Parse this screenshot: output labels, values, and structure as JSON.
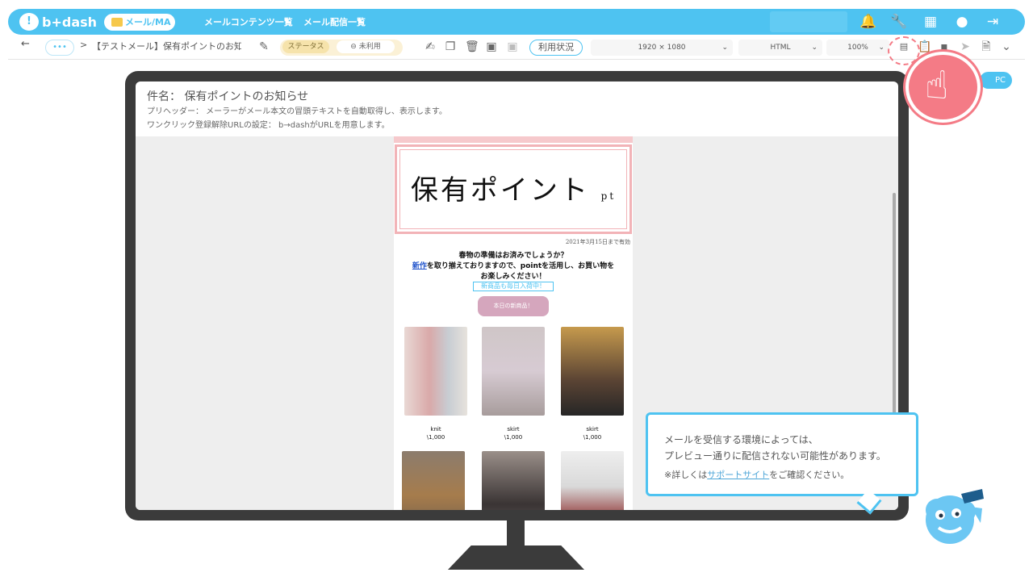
{
  "header": {
    "logo": "b+dash",
    "logo_mark": "!",
    "mail_ma": "メール/MA",
    "nav1": "メールコンテンツ一覧",
    "nav2": "メール配信一覧"
  },
  "toolbar": {
    "back": "←",
    "more": "•••",
    "crumb_sep": ">",
    "breadcrumb": "【テストメール】保有ポイントのお知…",
    "status": "ステータス",
    "unused": "未利用",
    "usage": "利用状況",
    "resolution": "1920 × 1080",
    "format": "HTML",
    "zoom": "100%"
  },
  "mail": {
    "subject_label": "件名：",
    "subject": "保有ポイントのお知らせ",
    "preheader": "プリヘッダー： メーラーがメール本文の冒頭テキストを自動取得し、表示します。",
    "unsubscribe": "ワンクリック登録解除URLの設定： b→dashがURLを用意します。"
  },
  "email_body": {
    "hero": "保有ポイント",
    "hero_unit": "pt",
    "expire": "2021年3月15日まで有効",
    "line1": "春物の準備はお済みでしょうか？",
    "line2_link": "新作",
    "line2": "を取り揃えておりますので、pointを活用し、お買い物を",
    "line3": "お楽しみください！",
    "new_tag": "新商品も毎日入荷中！",
    "cta": "本日の新商品！",
    "products": [
      {
        "name": "knit",
        "price": "\\1,000"
      },
      {
        "name": "skirt",
        "price": "\\1,000"
      },
      {
        "name": "skirt",
        "price": "\\1,000"
      }
    ]
  },
  "view_mode": "PC",
  "tooltip": {
    "line1": "メールを受信する環境によっては、",
    "line2": "プレビュー通りに配信されない可能性があります。",
    "line3_pre": "※詳しくは",
    "line3_link": "サポートサイト",
    "line3_post": "をご確認ください。"
  },
  "colors": {
    "accent": "#4ec3f1",
    "pink": "#f47b86"
  }
}
